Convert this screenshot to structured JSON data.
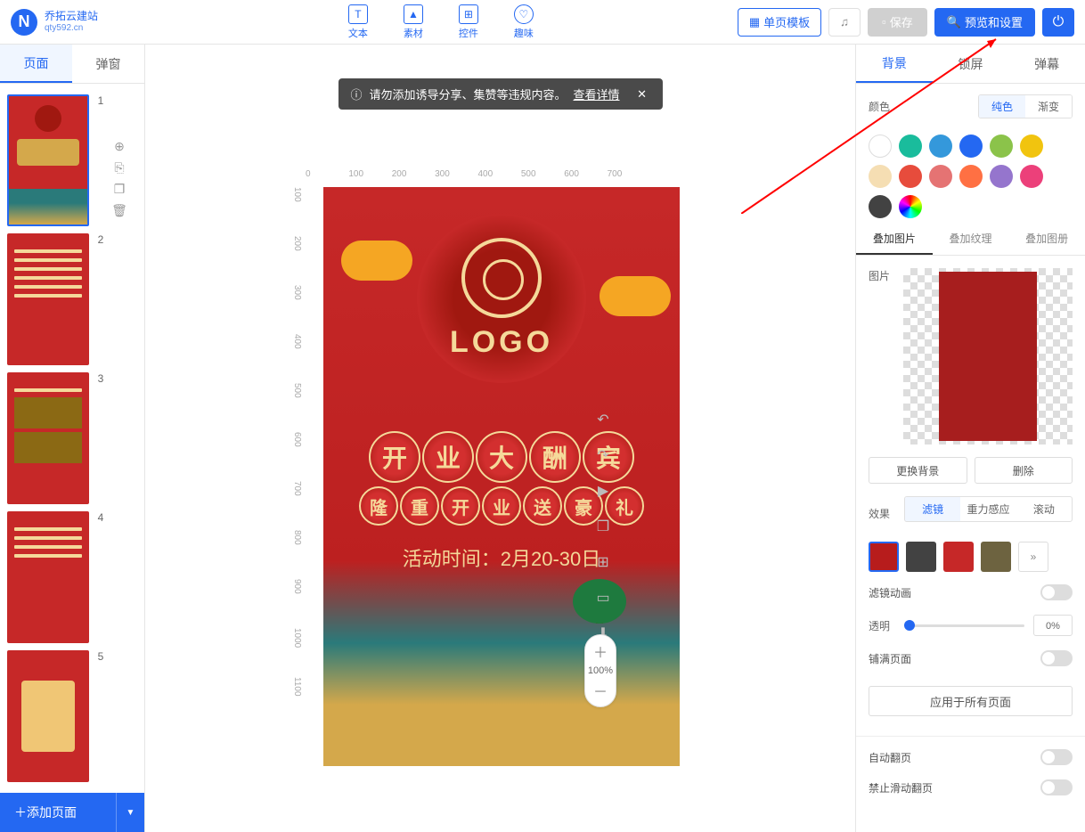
{
  "header": {
    "logo_title": "乔拓云建站",
    "logo_sub": "qty592.cn",
    "tools": [
      {
        "label": "文本",
        "name": "text-tool"
      },
      {
        "label": "素材",
        "name": "material-tool"
      },
      {
        "label": "控件",
        "name": "widget-tool"
      },
      {
        "label": "趣味",
        "name": "fun-tool"
      }
    ],
    "single_page_template": "单页模板",
    "save": "保存",
    "preview_settings": "预览和设置"
  },
  "left": {
    "tab_page": "页面",
    "tab_popup": "弹窗",
    "add_page": "添加页面",
    "page_numbers": [
      "1",
      "2",
      "3",
      "4",
      "5"
    ]
  },
  "warning": {
    "text": "请勿添加诱导分享、集赞等违规内容。",
    "link": "查看详情"
  },
  "ruler_h": [
    "0",
    "100",
    "200",
    "300",
    "400",
    "500",
    "600",
    "700"
  ],
  "ruler_v": [
    "100",
    "200",
    "300",
    "400",
    "500",
    "600",
    "700",
    "800",
    "900",
    "1000",
    "1100"
  ],
  "canvas": {
    "logo_text": "LOGO",
    "banner1": [
      "开",
      "业",
      "大",
      "酬",
      "宾"
    ],
    "banner2": [
      "隆",
      "重",
      "开",
      "业",
      "送",
      "豪",
      "礼"
    ],
    "date": "活动时间：2月20-30日"
  },
  "zoom": "100%",
  "right": {
    "tabs": [
      "背景",
      "锁屏",
      "弹幕"
    ],
    "color_label": "颜色",
    "color_mode": {
      "solid": "纯色",
      "gradient": "渐变"
    },
    "colors": [
      "#ffffff",
      "#1abc9c",
      "#3498db",
      "#2468f2",
      "#8bc34a",
      "#f1c40f",
      "#f5deb3",
      "#e74c3c",
      "#e57373",
      "#ff7043",
      "#9575cd",
      "#ec407a",
      "#424242",
      "rainbow"
    ],
    "overlay_tabs": [
      "叠加图片",
      "叠加纹理",
      "叠加图册"
    ],
    "image_label": "图片",
    "change_bg": "更换背景",
    "delete": "删除",
    "effect_label": "效果",
    "effect_tabs": [
      "滤镜",
      "重力感应",
      "滚动"
    ],
    "filter_colors": [
      "#b71c1c",
      "#424242",
      "#c62828",
      "#6d6340"
    ],
    "filter_anim": "滤镜动画",
    "opacity_label": "透明",
    "opacity_val": "0%",
    "fill_page": "铺满页面",
    "apply_all": "应用于所有页面",
    "auto_flip": "自动翻页",
    "no_swipe": "禁止滑动翻页"
  }
}
